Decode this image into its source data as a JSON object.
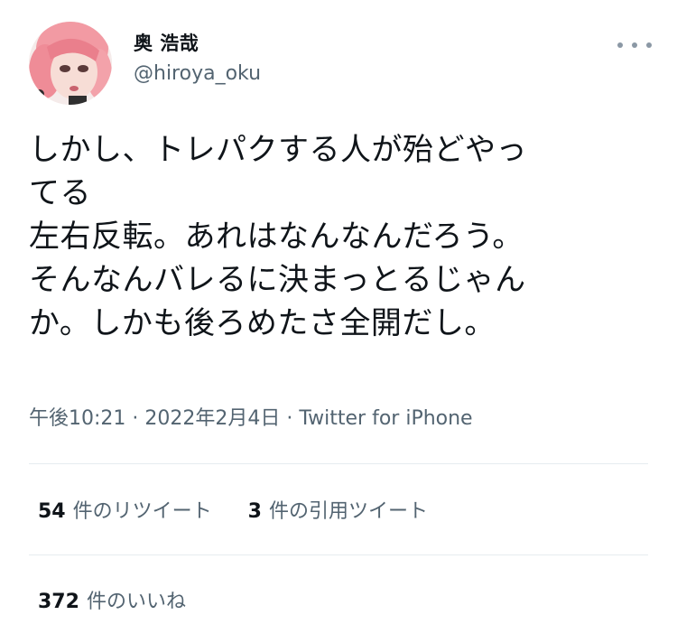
{
  "user": {
    "display_name": "奥 浩哉",
    "handle": "@hiroya_oku"
  },
  "icons": {
    "more": "more-options-icon",
    "avatar": "profile-avatar"
  },
  "tweet": {
    "lines": [
      "しかし、トレパクする人が殆どやっ",
      "てる",
      "左右反転。あれはなんなんだろう。",
      "そんなんバレるに決まっとるじゃん",
      "か。しかも後ろめたさ全開だし。"
    ]
  },
  "meta": {
    "time": "午後10:21",
    "separator": " · ",
    "date": "2022年2月4日",
    "source": "Twitter for iPhone"
  },
  "stats": {
    "retweets_count": "54",
    "retweets_label": "件のリツイート",
    "quotes_count": "3",
    "quotes_label": "件の引用ツイート",
    "likes_count": "372",
    "likes_label": "件のいいね"
  },
  "colors": {
    "text_primary": "#0f1419",
    "text_secondary": "#536471",
    "divider": "#e6ecf0",
    "avatar_hair": "#f29aa3"
  }
}
